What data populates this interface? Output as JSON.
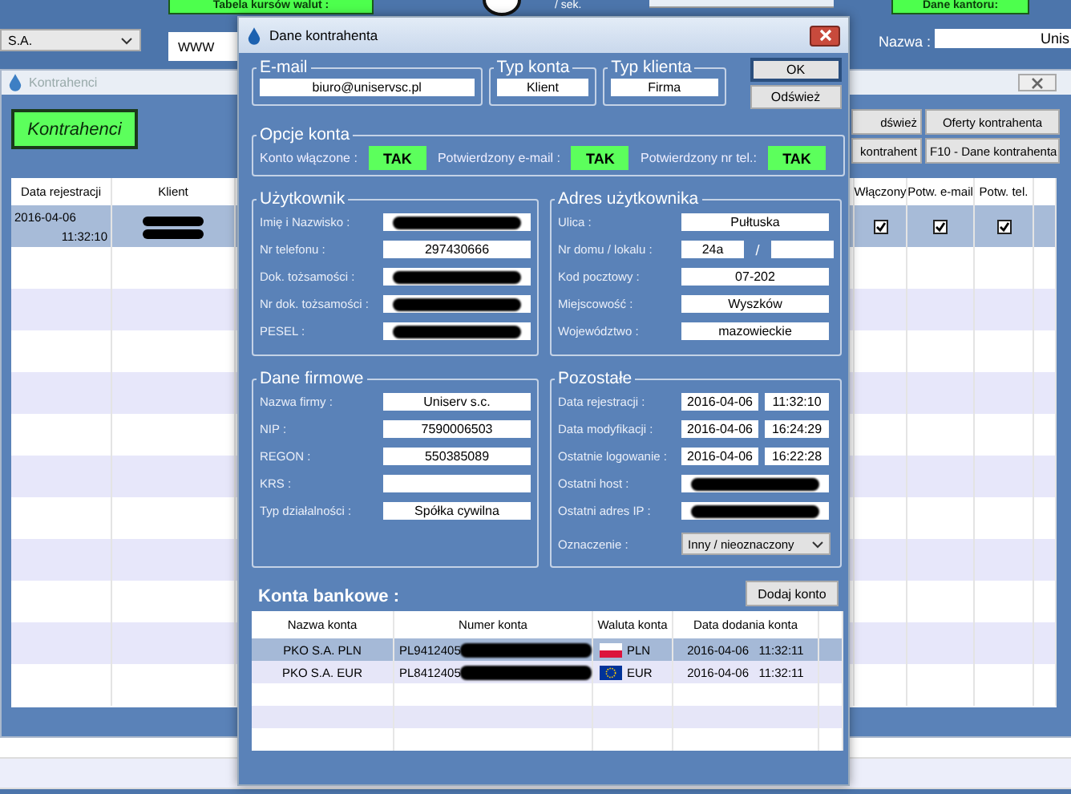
{
  "main_window": {
    "top_buttons": [
      "Tabela kursów walut :",
      "Dane kantoru:"
    ],
    "rate_unit": "/ sek.",
    "company_select": "S.A.",
    "www_field": "WWW",
    "name_label": "Nazwa :",
    "name_value": "Unis"
  },
  "contractors_window": {
    "title": "Kontrahenci",
    "heading_button": "Kontrahenci",
    "buttons": [
      "dśwież",
      "Oferty kontrahenta",
      "kontrahent",
      "F10 - Dane kontrahenta"
    ],
    "left_columns": [
      "Data rejestracji",
      "Klient"
    ],
    "right_columns": [
      "Włączony",
      "Potw. e-mail",
      "Potw. tel."
    ],
    "rows": [
      {
        "date": "2016-04-06",
        "time": "11:32:10",
        "client_redacted": true,
        "selected": true,
        "flags": [
          {
            "checked": true
          },
          {
            "checked": true
          },
          {
            "checked": true
          }
        ]
      }
    ]
  },
  "dialog": {
    "title": "Dane kontrahenta",
    "email": {
      "legend": "E-mail",
      "value": "biuro@uniservsc.pl"
    },
    "account_type": {
      "legend": "Typ konta",
      "value": "Klient"
    },
    "client_type": {
      "legend": "Typ klienta",
      "value": "Firma"
    },
    "buttons": [
      {
        "label": "OK",
        "default": true
      },
      {
        "label": "Odśwież",
        "default": false
      }
    ],
    "options": {
      "legend": "Opcje konta",
      "items": [
        {
          "label": "Konto włączone :",
          "value": "TAK",
          "on": true
        },
        {
          "label": "Potwierdzony e-mail :",
          "value": "TAK",
          "on": true
        },
        {
          "label": "Potwierdzony nr tel.:",
          "value": "TAK",
          "on": true
        }
      ]
    },
    "user": {
      "legend": "Użytkownik",
      "fields": [
        {
          "label": "Imię i Nazwisko :",
          "redacted": true
        },
        {
          "label": "Nr telefonu :",
          "value": "297430666",
          "redacted": false
        },
        {
          "label": "Dok. tożsamości :",
          "redacted": true
        },
        {
          "label": "Nr dok. tożsamości :",
          "redacted": true
        },
        {
          "label": "PESEL :",
          "redacted": true
        }
      ]
    },
    "address": {
      "legend": "Adres użytkownika",
      "fields": [
        {
          "kind": "text",
          "label": "Ulica :",
          "value": "Pułtuska"
        },
        {
          "kind": "split",
          "label": "Nr domu / lokalu :",
          "value": "24a",
          "separator": "/"
        },
        {
          "kind": "text",
          "label": "Kod pocztowy :",
          "value": "07-202"
        },
        {
          "kind": "text",
          "label": "Miejscowość :",
          "value": "Wyszków"
        },
        {
          "kind": "text",
          "label": "Województwo :",
          "value": "mazowieckie"
        }
      ]
    },
    "company": {
      "legend": "Dane firmowe",
      "fields": [
        {
          "label": "Nazwa firmy :",
          "value": "Uniserv s.c."
        },
        {
          "label": "NIP :",
          "value": "7590006503"
        },
        {
          "label": "REGON :",
          "value": "550385089"
        },
        {
          "label": "KRS :"
        },
        {
          "label": "Typ działalności :",
          "value": "Spółka cywilna"
        }
      ]
    },
    "other": {
      "legend": "Pozostałe",
      "fields": [
        {
          "kind": "datetime",
          "label": "Data rejestracji :",
          "date": "2016-04-06",
          "time": "11:32:10"
        },
        {
          "kind": "datetime",
          "label": "Data modyfikacji :",
          "date": "2016-04-06",
          "time": "16:24:29"
        },
        {
          "kind": "datetime",
          "label": "Ostatnie logowanie :",
          "date": "2016-04-06",
          "time": "16:22:28"
        },
        {
          "kind": "redacted",
          "label": "Ostatni host :"
        },
        {
          "kind": "redacted",
          "label": "Ostatni adres IP :"
        },
        {
          "kind": "select",
          "label": "Oznaczenie :",
          "value": "Inny / nieoznaczony"
        }
      ]
    },
    "bank": {
      "title": "Konta bankowe :",
      "add_button": "Dodaj konto",
      "columns": [
        "Nazwa konta",
        "Numer konta",
        "Waluta konta",
        "Data dodania konta"
      ],
      "rows": [
        {
          "name": "PKO S.A. PLN",
          "number": "PL9412405",
          "kind": "pl",
          "currency": "PLN",
          "added": "2016-04-06   11:32:11",
          "selected": true
        },
        {
          "name": "PKO S.A. EUR",
          "number": "PL8412405",
          "kind": "eu",
          "currency": "EUR",
          "added": "2016-04-06   11:32:11",
          "selected": false
        }
      ]
    }
  }
}
